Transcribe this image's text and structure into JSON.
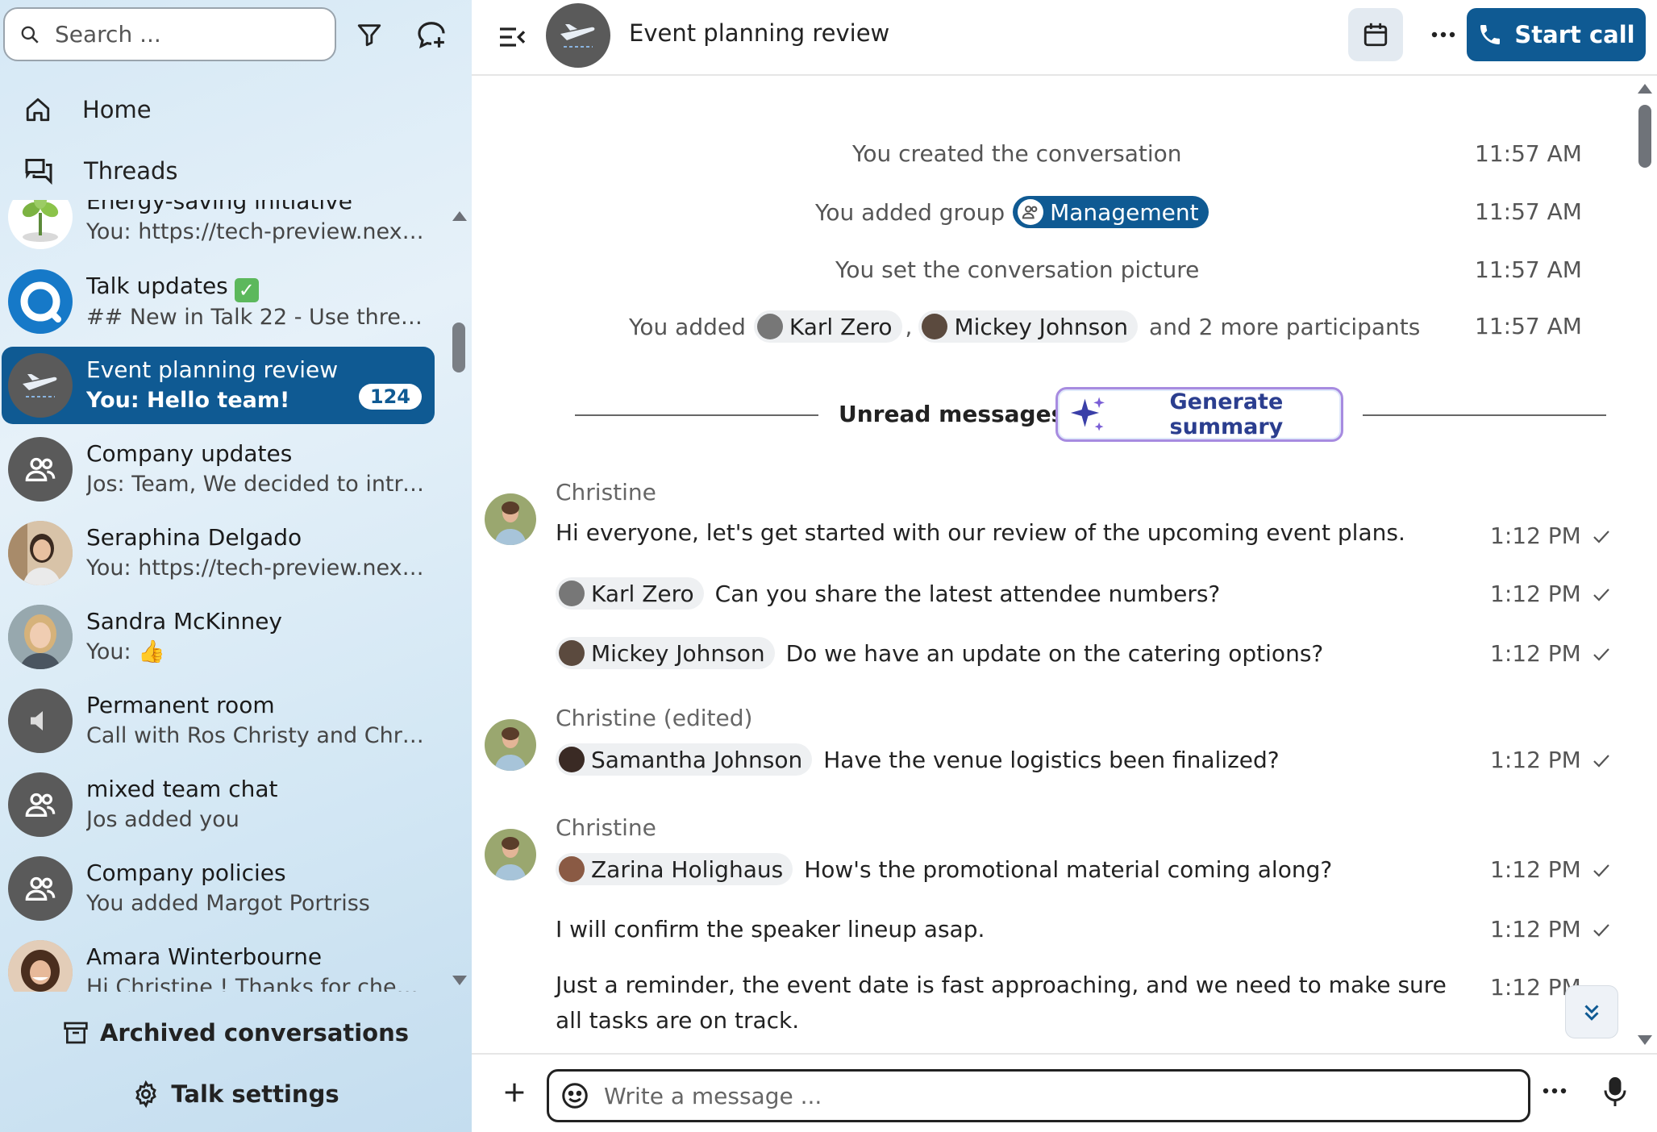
{
  "sidebar": {
    "search": {
      "placeholder": "Search ..."
    },
    "nav": {
      "home": "Home",
      "threads": "Threads"
    },
    "conversations": [
      {
        "name": "Energy-saving initiative",
        "preview": "You: https://tech-preview.next..."
      },
      {
        "name": "Talk updates",
        "preview": "## New in Talk 22 - Use threa..."
      },
      {
        "name": "Event planning review",
        "preview": "You: Hello team!",
        "badge": "124"
      },
      {
        "name": "Company updates",
        "preview": "Jos: Team, We decided to intro..."
      },
      {
        "name": "Seraphina Delgado",
        "preview": "You: https://tech-preview.next..."
      },
      {
        "name": "Sandra McKinney",
        "preview": "You: 👍"
      },
      {
        "name": "Permanent room",
        "preview": "Call with Ros Christy and Chris..."
      },
      {
        "name": "mixed team chat",
        "preview": "Jos added you"
      },
      {
        "name": "Company policies",
        "preview": "You added Margot Portriss"
      },
      {
        "name": "Amara Winterbourne",
        "preview": "Hi Christine ! Thanks for check..."
      }
    ],
    "archived": "Archived conversations",
    "settings": "Talk settings"
  },
  "header": {
    "title": "Event planning review",
    "start_call": "Start call"
  },
  "system_messages": [
    {
      "text": "You created the conversation",
      "time": "11:57 AM"
    },
    {
      "prefix": "You added group",
      "group": "Management",
      "time": "11:57 AM"
    },
    {
      "text": "You set the conversation picture",
      "time": "11:57 AM"
    },
    {
      "prefix": "You added",
      "p1": "Karl Zero",
      "sep": ",",
      "p2": "Mickey Johnson",
      "suffix": "and 2 more participants",
      "time": "11:57 AM"
    }
  ],
  "unread": {
    "label": "Unread messages",
    "generate": "Generate summary"
  },
  "messages": {
    "g1_author": "Christine",
    "m1": {
      "text": "Hi everyone, let's get started with our review of the upcoming event plans.",
      "time": "1:12 PM"
    },
    "m2": {
      "mention": "Karl Zero",
      "text": "Can you share the latest attendee numbers?",
      "time": "1:12 PM"
    },
    "m3": {
      "mention": "Mickey Johnson",
      "text": "Do we have an update on the catering options?",
      "time": "1:12 PM"
    },
    "g2_author": "Christine (edited)",
    "m4": {
      "mention": "Samantha Johnson",
      "text": "Have the venue logistics been finalized?",
      "time": "1:12 PM"
    },
    "g3_author": "Christine",
    "m5": {
      "mention": "Zarina Holighaus",
      "text": "How's the promotional material coming along?",
      "time": "1:12 PM"
    },
    "m6": {
      "text": "I will confirm the speaker lineup asap.",
      "time": "1:12 PM"
    },
    "m7": {
      "text": "Just a reminder, the event date is fast approaching, and we need to make sure all tasks are on track.",
      "time": "1:12 PM"
    }
  },
  "composer": {
    "placeholder": "Write a message ..."
  },
  "colors": {
    "primary": "#0f5a93",
    "sidebar_bg": "#dbeaf6",
    "summary_border": "#a78be0"
  }
}
